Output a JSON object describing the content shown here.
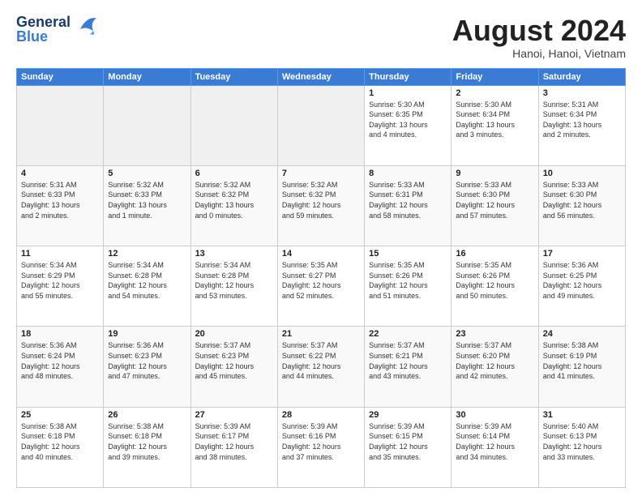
{
  "header": {
    "logo_line1": "General",
    "logo_line2": "Blue",
    "main_title": "August 2024",
    "subtitle": "Hanoi, Hanoi, Vietnam"
  },
  "weekdays": [
    "Sunday",
    "Monday",
    "Tuesday",
    "Wednesday",
    "Thursday",
    "Friday",
    "Saturday"
  ],
  "weeks": [
    [
      {
        "day": "",
        "info": "",
        "shaded": true
      },
      {
        "day": "",
        "info": "",
        "shaded": true
      },
      {
        "day": "",
        "info": "",
        "shaded": true
      },
      {
        "day": "",
        "info": "",
        "shaded": true
      },
      {
        "day": "1",
        "info": "Sunrise: 5:30 AM\nSunset: 6:35 PM\nDaylight: 13 hours\nand 4 minutes."
      },
      {
        "day": "2",
        "info": "Sunrise: 5:30 AM\nSunset: 6:34 PM\nDaylight: 13 hours\nand 3 minutes."
      },
      {
        "day": "3",
        "info": "Sunrise: 5:31 AM\nSunset: 6:34 PM\nDaylight: 13 hours\nand 2 minutes."
      }
    ],
    [
      {
        "day": "4",
        "info": "Sunrise: 5:31 AM\nSunset: 6:33 PM\nDaylight: 13 hours\nand 2 minutes."
      },
      {
        "day": "5",
        "info": "Sunrise: 5:32 AM\nSunset: 6:33 PM\nDaylight: 13 hours\nand 1 minute."
      },
      {
        "day": "6",
        "info": "Sunrise: 5:32 AM\nSunset: 6:32 PM\nDaylight: 13 hours\nand 0 minutes."
      },
      {
        "day": "7",
        "info": "Sunrise: 5:32 AM\nSunset: 6:32 PM\nDaylight: 12 hours\nand 59 minutes."
      },
      {
        "day": "8",
        "info": "Sunrise: 5:33 AM\nSunset: 6:31 PM\nDaylight: 12 hours\nand 58 minutes."
      },
      {
        "day": "9",
        "info": "Sunrise: 5:33 AM\nSunset: 6:30 PM\nDaylight: 12 hours\nand 57 minutes."
      },
      {
        "day": "10",
        "info": "Sunrise: 5:33 AM\nSunset: 6:30 PM\nDaylight: 12 hours\nand 56 minutes."
      }
    ],
    [
      {
        "day": "11",
        "info": "Sunrise: 5:34 AM\nSunset: 6:29 PM\nDaylight: 12 hours\nand 55 minutes."
      },
      {
        "day": "12",
        "info": "Sunrise: 5:34 AM\nSunset: 6:28 PM\nDaylight: 12 hours\nand 54 minutes."
      },
      {
        "day": "13",
        "info": "Sunrise: 5:34 AM\nSunset: 6:28 PM\nDaylight: 12 hours\nand 53 minutes."
      },
      {
        "day": "14",
        "info": "Sunrise: 5:35 AM\nSunset: 6:27 PM\nDaylight: 12 hours\nand 52 minutes."
      },
      {
        "day": "15",
        "info": "Sunrise: 5:35 AM\nSunset: 6:26 PM\nDaylight: 12 hours\nand 51 minutes."
      },
      {
        "day": "16",
        "info": "Sunrise: 5:35 AM\nSunset: 6:26 PM\nDaylight: 12 hours\nand 50 minutes."
      },
      {
        "day": "17",
        "info": "Sunrise: 5:36 AM\nSunset: 6:25 PM\nDaylight: 12 hours\nand 49 minutes."
      }
    ],
    [
      {
        "day": "18",
        "info": "Sunrise: 5:36 AM\nSunset: 6:24 PM\nDaylight: 12 hours\nand 48 minutes."
      },
      {
        "day": "19",
        "info": "Sunrise: 5:36 AM\nSunset: 6:23 PM\nDaylight: 12 hours\nand 47 minutes."
      },
      {
        "day": "20",
        "info": "Sunrise: 5:37 AM\nSunset: 6:23 PM\nDaylight: 12 hours\nand 45 minutes."
      },
      {
        "day": "21",
        "info": "Sunrise: 5:37 AM\nSunset: 6:22 PM\nDaylight: 12 hours\nand 44 minutes."
      },
      {
        "day": "22",
        "info": "Sunrise: 5:37 AM\nSunset: 6:21 PM\nDaylight: 12 hours\nand 43 minutes."
      },
      {
        "day": "23",
        "info": "Sunrise: 5:37 AM\nSunset: 6:20 PM\nDaylight: 12 hours\nand 42 minutes."
      },
      {
        "day": "24",
        "info": "Sunrise: 5:38 AM\nSunset: 6:19 PM\nDaylight: 12 hours\nand 41 minutes."
      }
    ],
    [
      {
        "day": "25",
        "info": "Sunrise: 5:38 AM\nSunset: 6:18 PM\nDaylight: 12 hours\nand 40 minutes."
      },
      {
        "day": "26",
        "info": "Sunrise: 5:38 AM\nSunset: 6:18 PM\nDaylight: 12 hours\nand 39 minutes."
      },
      {
        "day": "27",
        "info": "Sunrise: 5:39 AM\nSunset: 6:17 PM\nDaylight: 12 hours\nand 38 minutes."
      },
      {
        "day": "28",
        "info": "Sunrise: 5:39 AM\nSunset: 6:16 PM\nDaylight: 12 hours\nand 37 minutes."
      },
      {
        "day": "29",
        "info": "Sunrise: 5:39 AM\nSunset: 6:15 PM\nDaylight: 12 hours\nand 35 minutes."
      },
      {
        "day": "30",
        "info": "Sunrise: 5:39 AM\nSunset: 6:14 PM\nDaylight: 12 hours\nand 34 minutes."
      },
      {
        "day": "31",
        "info": "Sunrise: 5:40 AM\nSunset: 6:13 PM\nDaylight: 12 hours\nand 33 minutes."
      }
    ]
  ]
}
